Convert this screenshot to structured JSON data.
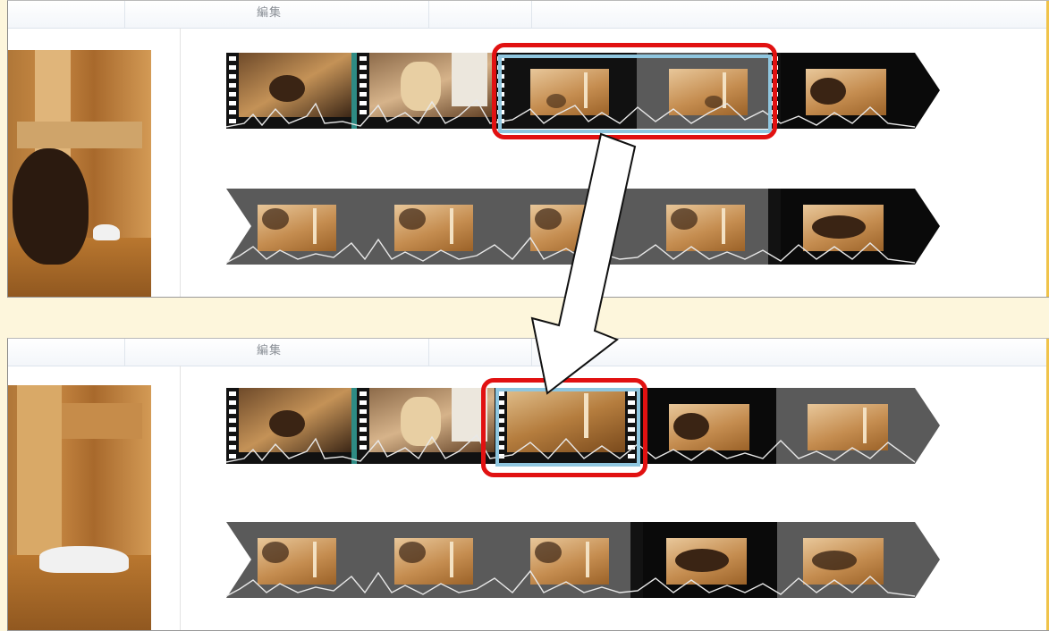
{
  "ribbon": {
    "edit_tab_label": "編集"
  },
  "panels": [
    {
      "id": "before",
      "tab_label": "編集"
    },
    {
      "id": "after",
      "tab_label": "編集"
    }
  ],
  "colors": {
    "highlight": "#e11111",
    "selection": "#8fc6df",
    "film_separator": "#2e8b84",
    "track_background": "#5a5a5a",
    "arrow_fill": "#ffffff"
  },
  "icons": [
    "big-down-arrow-icon"
  ]
}
